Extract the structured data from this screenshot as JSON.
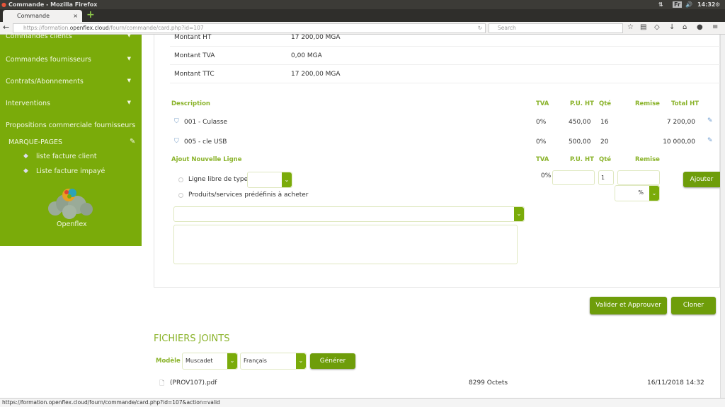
{
  "window": {
    "title": "Commande - Mozilla Firefox",
    "tab": "Commande",
    "clock": "14:32",
    "lang": "Fr"
  },
  "browser": {
    "url_prefix": "https://formation.",
    "url_domain": "openflex.cloud",
    "url_path": "/fourn/commande/card.php?id=107",
    "search_placeholder": "Search"
  },
  "sidebar": {
    "items": [
      {
        "label": "Commandes clients"
      },
      {
        "label": "Commandes fournisseurs"
      },
      {
        "label": "Contrats/Abonnements"
      },
      {
        "label": "Interventions"
      },
      {
        "label": "Propositions commerciale fournisseurs"
      }
    ],
    "bookmarks_title": "MARQUE-PAGES",
    "bookmarks": [
      {
        "label": "liste facture client"
      },
      {
        "label": "Liste facture impayé"
      }
    ],
    "logo_text": "Openflex"
  },
  "summary": [
    {
      "label": "Montant HT",
      "value": "17 200,00 MGA"
    },
    {
      "label": "Montant TVA",
      "value": "0,00 MGA"
    },
    {
      "label": "Montant TTC",
      "value": "17 200,00 MGA"
    }
  ],
  "lines": {
    "headers": {
      "description": "Description",
      "tva": "TVA",
      "pu": "P.U. HT",
      "qty": "Qté",
      "remise": "Remise",
      "total": "Total HT"
    },
    "rows": [
      {
        "desc": "001 - Culasse",
        "tva": "0%",
        "pu": "450,00",
        "qty": "16",
        "total": "7 200,00"
      },
      {
        "desc": "005 - cle USB",
        "tva": "0%",
        "pu": "500,00",
        "qty": "20",
        "total": "10 000,00"
      }
    ]
  },
  "new_line": {
    "title": "Ajout Nouvelle Ligne",
    "tva_header": "TVA",
    "pu_header": "P.U. HT",
    "qty_header": "Qté",
    "remise_header": "Remise",
    "option_free": "Ligne libre de type",
    "option_predef": "Produits/services prédéfinis à acheter",
    "tva_value": "0%",
    "qty_value": "1",
    "remise_unit": "%",
    "add_button": "Ajouter"
  },
  "actions": {
    "validate": "Valider et Approuver",
    "clone": "Cloner"
  },
  "files": {
    "title": "FICHIERS JOINTS",
    "model_label": "Modèle",
    "model_value": "Muscadet",
    "lang_value": "Français",
    "generate": "Générer",
    "items": [
      {
        "name": "(PROV107).pdf",
        "size": "8299 Octets",
        "date": "16/11/2018 14:32"
      }
    ]
  },
  "status_bar": "https://formation.openflex.cloud/fourn/commande/card.php?id=107&action=valid",
  "colors": {
    "sidebar": "#7aab0a",
    "accent": "#8ab32a",
    "button": "#6e9d0a"
  }
}
